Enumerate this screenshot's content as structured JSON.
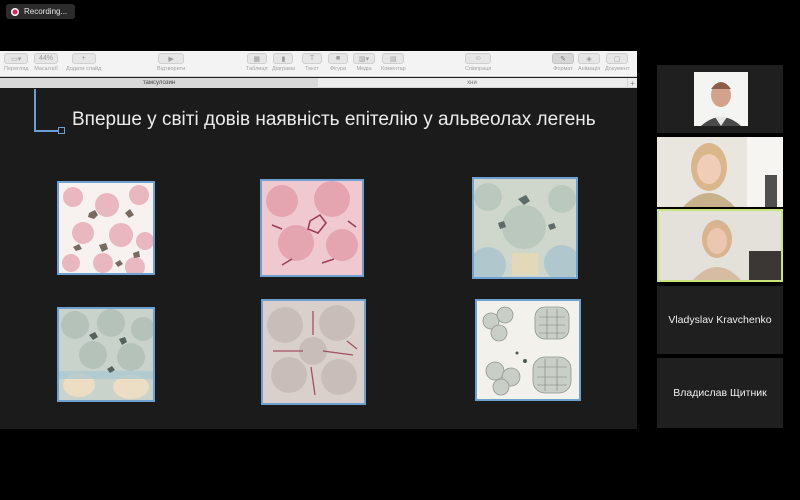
{
  "recording": {
    "label": "Recording..."
  },
  "toolbar": {
    "items": [
      {
        "label": "Перегляд",
        "icon": "view-icon"
      },
      {
        "label": "Масштаб",
        "value": "44%",
        "icon": "zoom-icon"
      },
      {
        "label": "Додати слайд",
        "icon": "add-slide-icon"
      },
      {
        "label": "Відтворити",
        "icon": "play-icon"
      },
      {
        "label": "Таблиця",
        "icon": "table-icon"
      },
      {
        "label": "Діаграма",
        "icon": "chart-icon"
      },
      {
        "label": "Текст",
        "icon": "text-icon"
      },
      {
        "label": "Фігура",
        "icon": "shape-icon"
      },
      {
        "label": "Медіа",
        "icon": "media-icon"
      },
      {
        "label": "Коментар",
        "icon": "comment-icon"
      },
      {
        "label": "Співпраця",
        "icon": "collaborate-icon"
      },
      {
        "label": "Формат",
        "icon": "format-icon"
      },
      {
        "label": "Анімація",
        "icon": "animation-icon"
      },
      {
        "label": "Документ",
        "icon": "document-icon"
      }
    ]
  },
  "tabs": [
    {
      "label": "тамсулозин"
    },
    {
      "label": "хни"
    }
  ],
  "slide": {
    "title": "Вперше у світі довів наявність епітелію у альвеолах легень"
  },
  "participants": [
    {
      "name": "Vladyslav Kravchenko"
    },
    {
      "name": "Владислав Щитник"
    }
  ],
  "colors": {
    "accent_blue": "#6a9fd8",
    "active_speaker": "#c9e37c",
    "record_red": "#e0245e"
  }
}
